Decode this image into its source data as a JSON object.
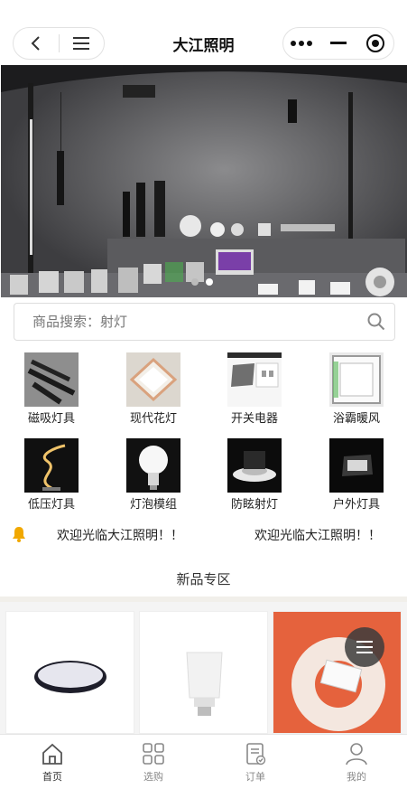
{
  "header": {
    "title": "大江照明",
    "back_icon": "back-icon",
    "menu_icon": "menu-icon",
    "more_icon": "more-icon",
    "minimize_icon": "minimize-icon",
    "close_icon": "target-close-icon"
  },
  "banner": {
    "slide_count": 2,
    "active_slide": 1
  },
  "search": {
    "placeholder": "商品搜索：射灯",
    "icon": "search-icon"
  },
  "categories": [
    {
      "label": "磁吸灯具"
    },
    {
      "label": "现代花灯"
    },
    {
      "label": "开关电器"
    },
    {
      "label": "浴霸暖风"
    },
    {
      "label": "低压灯具"
    },
    {
      "label": "灯泡模组"
    },
    {
      "label": "防眩射灯"
    },
    {
      "label": "户外灯具"
    }
  ],
  "notice": {
    "icon": "bell-icon",
    "text_1": "欢迎光临大江照明！！",
    "text_2": "欢迎光临大江照明！！"
  },
  "section": {
    "title": "新品专区"
  },
  "tabbar": {
    "items": [
      {
        "label": "首页",
        "icon": "home-icon",
        "active": true
      },
      {
        "label": "选购",
        "icon": "grid-icon",
        "active": false
      },
      {
        "label": "订单",
        "icon": "order-icon",
        "active": false
      },
      {
        "label": "我的",
        "icon": "user-icon",
        "active": false
      }
    ]
  },
  "colors": {
    "accent": "#f1a800",
    "banner_bg": "#4a4a4c"
  }
}
